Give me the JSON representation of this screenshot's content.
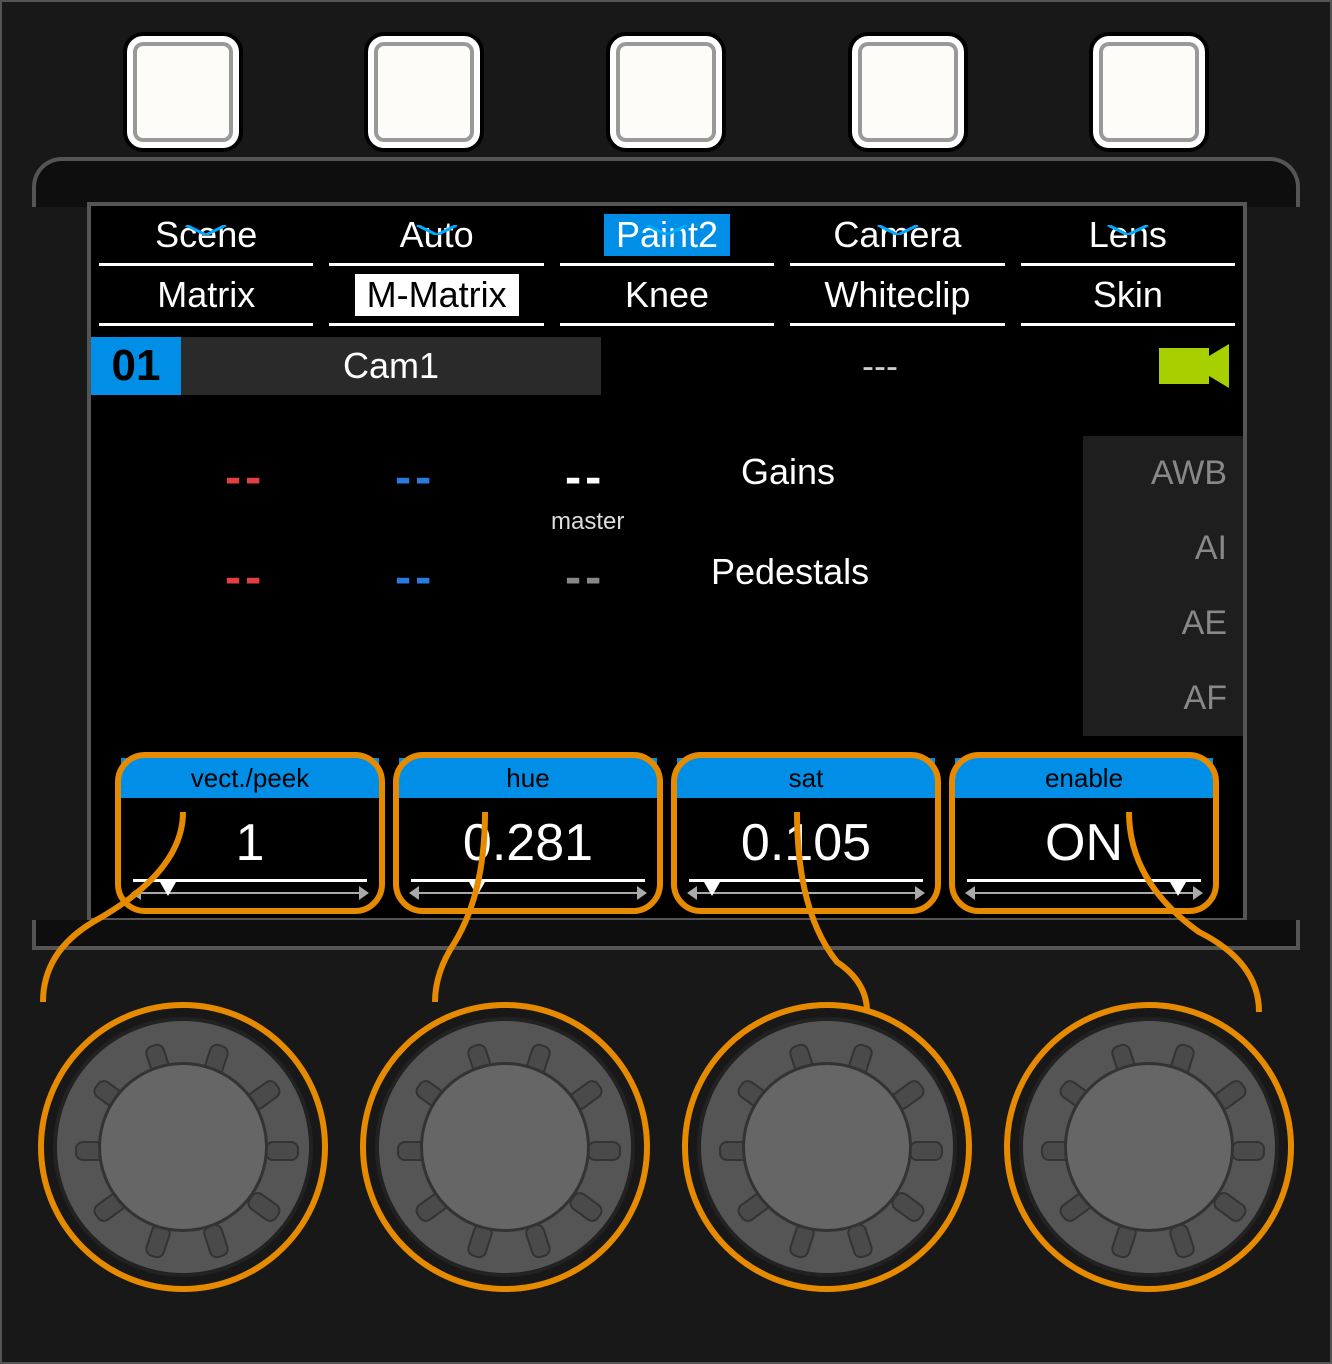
{
  "tabs_top": [
    {
      "label": "Scene",
      "state": ""
    },
    {
      "label": "Auto",
      "state": ""
    },
    {
      "label": "Paint2",
      "state": "active"
    },
    {
      "label": "Camera",
      "state": ""
    },
    {
      "label": "Lens",
      "state": ""
    }
  ],
  "tabs_bottom": [
    {
      "label": "Matrix",
      "state": ""
    },
    {
      "label": "M-Matrix",
      "state": "sel"
    },
    {
      "label": "Knee",
      "state": ""
    },
    {
      "label": "Whiteclip",
      "state": ""
    },
    {
      "label": "Skin",
      "state": ""
    }
  ],
  "camera": {
    "number": "01",
    "name": "Cam1",
    "aux": "---"
  },
  "mid_labels": {
    "gains": "Gains",
    "pedestals": "Pedestals",
    "master": "master"
  },
  "side_funcs": [
    "AWB",
    "AI",
    "AE",
    "AF"
  ],
  "encoders": [
    {
      "title": "vect./peek",
      "value": "1",
      "pos": 0.15
    },
    {
      "title": "hue",
      "value": "0.281",
      "pos": 0.28
    },
    {
      "title": "sat",
      "value": "0.105",
      "pos": 0.1
    },
    {
      "title": "enable",
      "value": "ON",
      "pos": 0.9
    }
  ],
  "dash": "--"
}
